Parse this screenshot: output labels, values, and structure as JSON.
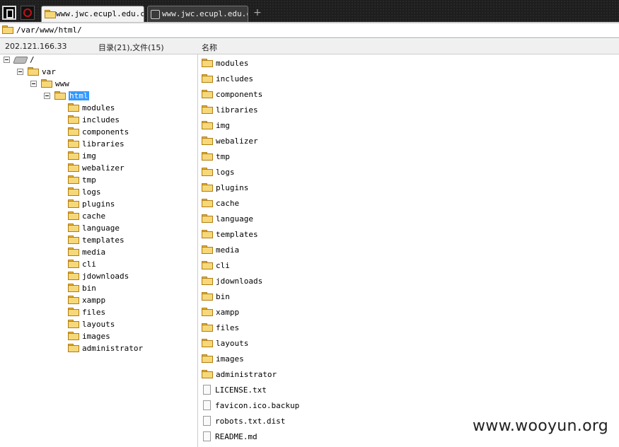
{
  "tabs": [
    {
      "label": "www.jwc.ecupl.edu.cn",
      "active": true
    },
    {
      "label": "www.jwc.ecupl.edu.cn",
      "active": false
    }
  ],
  "new_tab_label": "+",
  "address": {
    "path": "/var/www/html/"
  },
  "header": {
    "ip": "202.121.166.33",
    "summary": "目录(21),文件(15)",
    "name_column": "名称"
  },
  "tree": {
    "root": "/",
    "var": "var",
    "www": "www",
    "html": "html",
    "children": [
      "modules",
      "includes",
      "components",
      "libraries",
      "img",
      "webalizer",
      "tmp",
      "logs",
      "plugins",
      "cache",
      "language",
      "templates",
      "media",
      "cli",
      "jdownloads",
      "bin",
      "xampp",
      "files",
      "layouts",
      "images",
      "administrator"
    ]
  },
  "list": {
    "folders": [
      "modules",
      "includes",
      "components",
      "libraries",
      "img",
      "webalizer",
      "tmp",
      "logs",
      "plugins",
      "cache",
      "language",
      "templates",
      "media",
      "cli",
      "jdownloads",
      "bin",
      "xampp",
      "files",
      "layouts",
      "images",
      "administrator"
    ],
    "files": [
      "LICENSE.txt",
      "favicon.ico.backup",
      "robots.txt.dist",
      "README.md"
    ]
  },
  "watermark": "www.wooyun.org",
  "colors": {
    "selection": "#3399ff",
    "folder": "#f6d87a",
    "tabbar": "#1e1e1e"
  }
}
